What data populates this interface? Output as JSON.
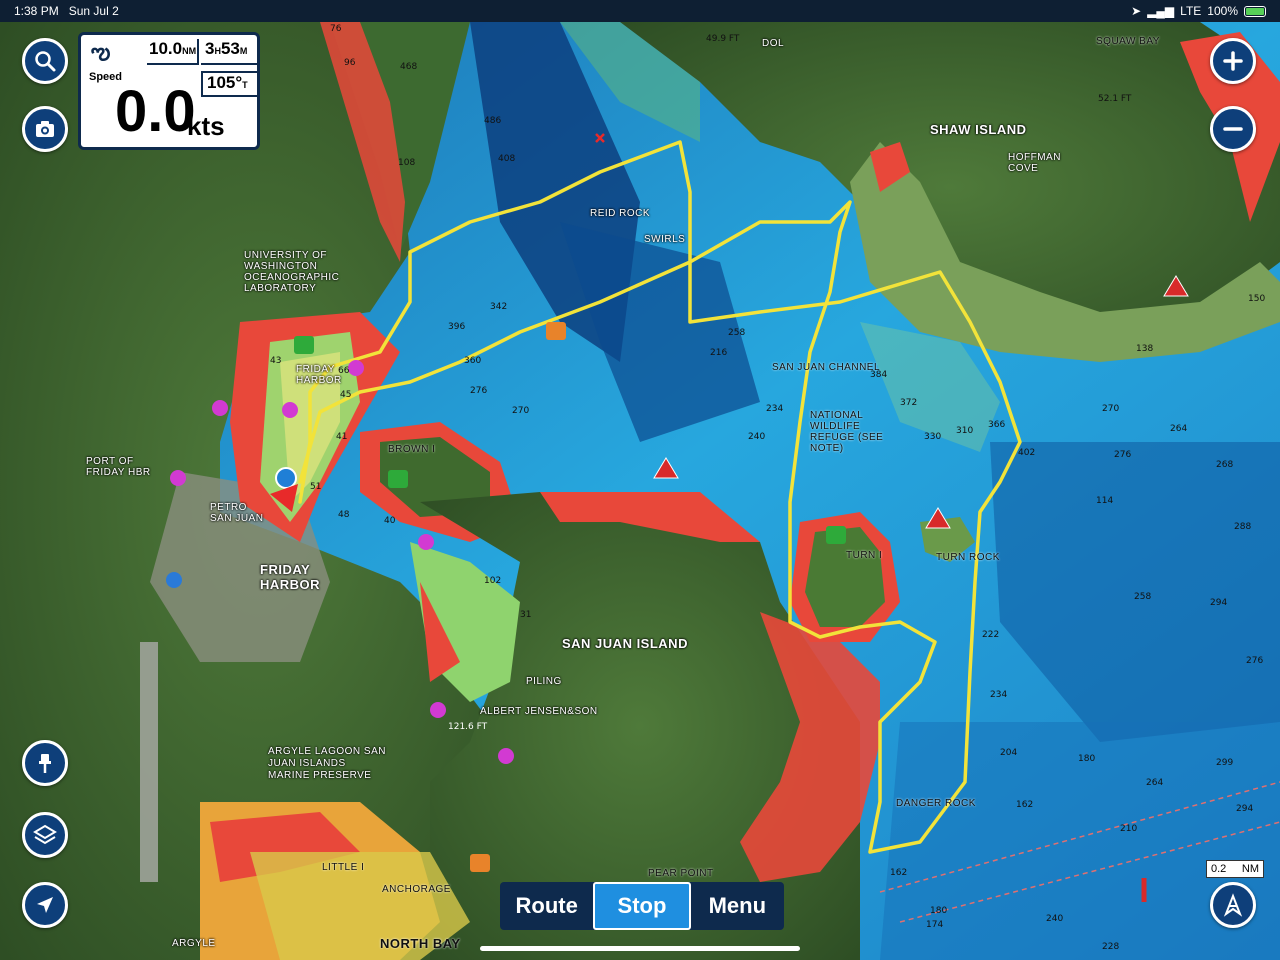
{
  "status_bar": {
    "time": "1:38 PM",
    "date": "Sun Jul 2",
    "network": "LTE",
    "battery": "100%"
  },
  "nav_panel": {
    "distance_value": "10.0",
    "distance_unit": "NM",
    "eta_hours": "3",
    "eta_h_unit": "H",
    "eta_minutes": "53",
    "eta_m_unit": "M",
    "speed_label": "Speed",
    "speed_value": "0.0",
    "speed_unit": "kts",
    "heading_value": "105°",
    "heading_unit": "T"
  },
  "map_labels": {
    "shaw_island": "SHAW ISLAND",
    "squaw_bay": "SQUAW BAY",
    "hoffman_cove": "HOFFMAN COVE",
    "univ_lab": "UNIVERSITY OF WASHINGTON OCEANOGRAPHIC LABORATORY",
    "friday_harbor_water": "FRIDAY HARBOR",
    "port_of_friday": "PORT OF FRIDAY HBR",
    "petro": "PETRO SAN JUAN",
    "friday_harbor_town": "FRIDAY HARBOR",
    "brown_i": "BROWN I",
    "reid_rock": "REID ROCK",
    "swirls": "SWIRLS",
    "san_juan_channel": "SAN JUAN CHANNEL",
    "nwr": "NATIONAL WILDLIFE REFUGE (SEE NOTE)",
    "turn_i": "TURN I",
    "turn_rock": "TURN ROCK",
    "san_juan_island": "SAN JUAN ISLAND",
    "piling": "PILING",
    "albert": "ALBERT JENSEN&SON",
    "argyle_lagoon": "ARGYLE LAGOON SAN JUAN ISLANDS MARINE PRESERVE",
    "little_i": "LITTLE I",
    "anchorage": "ANCHORAGE",
    "north_bay": "NORTH BAY",
    "pear_point": "PEAR POINT",
    "danger_rock": "DANGER ROCK",
    "argyle": "ARGYLE",
    "dol": "DOL",
    "ft_499": "49.9 FT",
    "ft_521": "52.1 FT",
    "ft_1216": "121.6 FT"
  },
  "depths": [
    "76",
    "96",
    "468",
    "486",
    "408",
    "108",
    "396",
    "342",
    "360",
    "276",
    "270",
    "258",
    "216",
    "240",
    "234",
    "384",
    "372",
    "330",
    "310",
    "366",
    "402",
    "270",
    "264",
    "288",
    "276",
    "294",
    "268",
    "258",
    "234",
    "222",
    "204",
    "180",
    "264",
    "210",
    "294",
    "299",
    "276",
    "150",
    "138",
    "114",
    "162",
    "180",
    "174",
    "240",
    "228",
    "162",
    "102",
    "31",
    "51",
    "48",
    "40",
    "45",
    "43",
    "66",
    "41"
  ],
  "bottom_bar": {
    "route": "Route",
    "stop": "Stop",
    "menu": "Menu"
  },
  "scale_bar": {
    "value": "0.2",
    "unit": "NM"
  },
  "icons": {
    "search": "search-icon",
    "camera": "camera-icon",
    "zoom_in": "plus-icon",
    "zoom_out": "minus-icon",
    "pin": "pin-icon",
    "layers": "layers-icon",
    "location": "location-arrow-icon",
    "anchor_mode": "anchor-person-icon"
  },
  "colors": {
    "track": "#f2e33a",
    "panel_border": "#0e2a4d",
    "button_bg": "#0e3f7a",
    "active_tab": "#1f8fe0",
    "deep_water": "#1e9ad6",
    "shallow_water": "#8fd8e8",
    "shore_red": "#e8483a"
  }
}
